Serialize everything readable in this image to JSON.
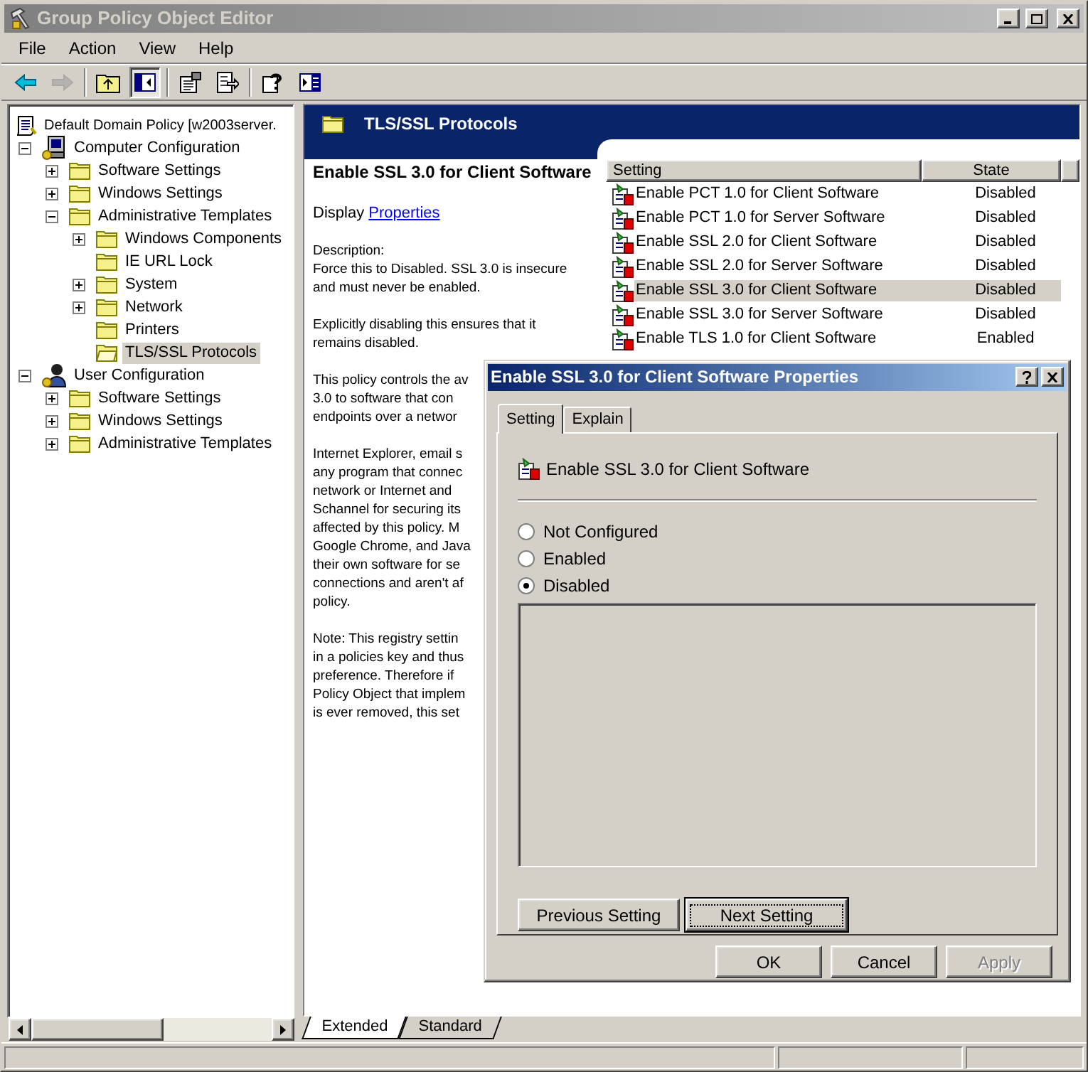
{
  "window": {
    "title": "Group Policy Object Editor",
    "active": false
  },
  "menu": [
    {
      "label": "File"
    },
    {
      "label": "Action"
    },
    {
      "label": "View"
    },
    {
      "label": "Help"
    }
  ],
  "toolbar": [
    {
      "kind": "back",
      "disabled": false,
      "pressed": false
    },
    {
      "kind": "forward",
      "disabled": true,
      "pressed": false
    },
    {
      "kind": "up",
      "disabled": false,
      "pressed": false
    },
    {
      "kind": "tree",
      "disabled": false,
      "pressed": true
    },
    {
      "kind": "properties",
      "disabled": false,
      "pressed": false
    },
    {
      "kind": "export",
      "disabled": false,
      "pressed": false
    },
    {
      "kind": "help",
      "disabled": false,
      "pressed": false
    },
    {
      "kind": "panel",
      "disabled": false,
      "pressed": false
    }
  ],
  "tree": [
    {
      "label": "Default Domain Policy [w2003server.",
      "kind": "policy",
      "selected": false,
      "children": [
        {
          "label": "Computer Configuration",
          "kind": "computer",
          "expandable": true,
          "selected": false,
          "children": [
            {
              "label": "Software Settings",
              "kind": "folder",
              "expandable": true,
              "selected": false
            },
            {
              "label": "Windows Settings",
              "kind": "folder",
              "expandable": true,
              "selected": false
            },
            {
              "label": "Administrative Templates",
              "kind": "folder",
              "expandable": true,
              "selected": false,
              "children": [
                {
                  "label": "Windows Components",
                  "kind": "folder",
                  "expandable": true,
                  "selected": false
                },
                {
                  "label": "IE URL Lock",
                  "kind": "folder",
                  "expandable": false,
                  "selected": false
                },
                {
                  "label": "System",
                  "kind": "folder",
                  "expandable": true,
                  "selected": false
                },
                {
                  "label": "Network",
                  "kind": "folder",
                  "expandable": true,
                  "selected": false
                },
                {
                  "label": "Printers",
                  "kind": "folder",
                  "expandable": false,
                  "selected": false
                },
                {
                  "label": "TLS/SSL Protocols",
                  "kind": "open-folder",
                  "expandable": false,
                  "selected": true
                }
              ]
            }
          ]
        },
        {
          "label": "User Configuration",
          "kind": "user",
          "expandable": true,
          "selected": false,
          "children": [
            {
              "label": "Software Settings",
              "kind": "folder",
              "expandable": true,
              "selected": false
            },
            {
              "label": "Windows Settings",
              "kind": "folder",
              "expandable": true,
              "selected": false
            },
            {
              "label": "Administrative Templates",
              "kind": "folder",
              "expandable": true,
              "selected": false
            }
          ]
        }
      ]
    }
  ],
  "details": {
    "header": "TLS/SSL Protocols",
    "title": "Enable SSL 3.0 for Client Software",
    "display_prefix": "Display",
    "link": "Properties",
    "paragraphs": [
      [
        "Description:",
        "Force this to Disabled. SSL 3.0 is insecure",
        "and must never be enabled."
      ],
      [
        "Explicitly disabling this ensures that it",
        "remains disabled."
      ],
      [
        "This policy controls the av",
        "3.0 to software that con",
        "endpoints over a networ"
      ],
      [
        "Internet Explorer, email s",
        "any program that connec",
        "network or Internet and",
        "Schannel for securing its",
        "affected by this policy. M",
        "Google Chrome, and Java",
        "their own software for se",
        "connections and aren't af",
        "policy."
      ],
      [
        "Note:  This registry settin",
        "in a policies key and thus",
        "preference.  Therefore if",
        "Policy Object that implem",
        "is ever removed, this set"
      ]
    ]
  },
  "list": {
    "columns": [
      "Setting",
      "State"
    ],
    "rows": [
      {
        "setting": "Enable PCT 1.0 for Client Software",
        "state": "Disabled",
        "selected": false
      },
      {
        "setting": "Enable PCT 1.0 for Server Software",
        "state": "Disabled",
        "selected": false
      },
      {
        "setting": "Enable SSL 2.0 for Client Software",
        "state": "Disabled",
        "selected": false
      },
      {
        "setting": "Enable SSL 2.0 for Server Software",
        "state": "Disabled",
        "selected": false
      },
      {
        "setting": "Enable SSL 3.0 for Client Software",
        "state": "Disabled",
        "selected": true
      },
      {
        "setting": "Enable SSL 3.0 for Server Software",
        "state": "Disabled",
        "selected": false
      },
      {
        "setting": "Enable TLS 1.0 for Client Software",
        "state": "Enabled",
        "selected": false
      }
    ]
  },
  "view_tabs": [
    {
      "label": "Extended",
      "selected": true
    },
    {
      "label": "Standard",
      "selected": false
    }
  ],
  "dialog": {
    "title": "Enable SSL 3.0 for Client Software Properties",
    "active": true,
    "tabs": [
      {
        "label": "Setting",
        "selected": true
      },
      {
        "label": "Explain",
        "selected": false
      }
    ],
    "setting_title": "Enable SSL 3.0 for Client Software",
    "options": [
      {
        "label": "Not Configured",
        "selected": false
      },
      {
        "label": "Enabled",
        "selected": false
      },
      {
        "label": "Disabled",
        "selected": true
      }
    ],
    "nav_buttons": [
      {
        "label": "Previous Setting",
        "default": false
      },
      {
        "label": "Next Setting",
        "default": true
      }
    ],
    "buttons": [
      {
        "label": "OK",
        "disabled": false
      },
      {
        "label": "Cancel",
        "disabled": false
      },
      {
        "label": "Apply",
        "disabled": true
      }
    ]
  }
}
